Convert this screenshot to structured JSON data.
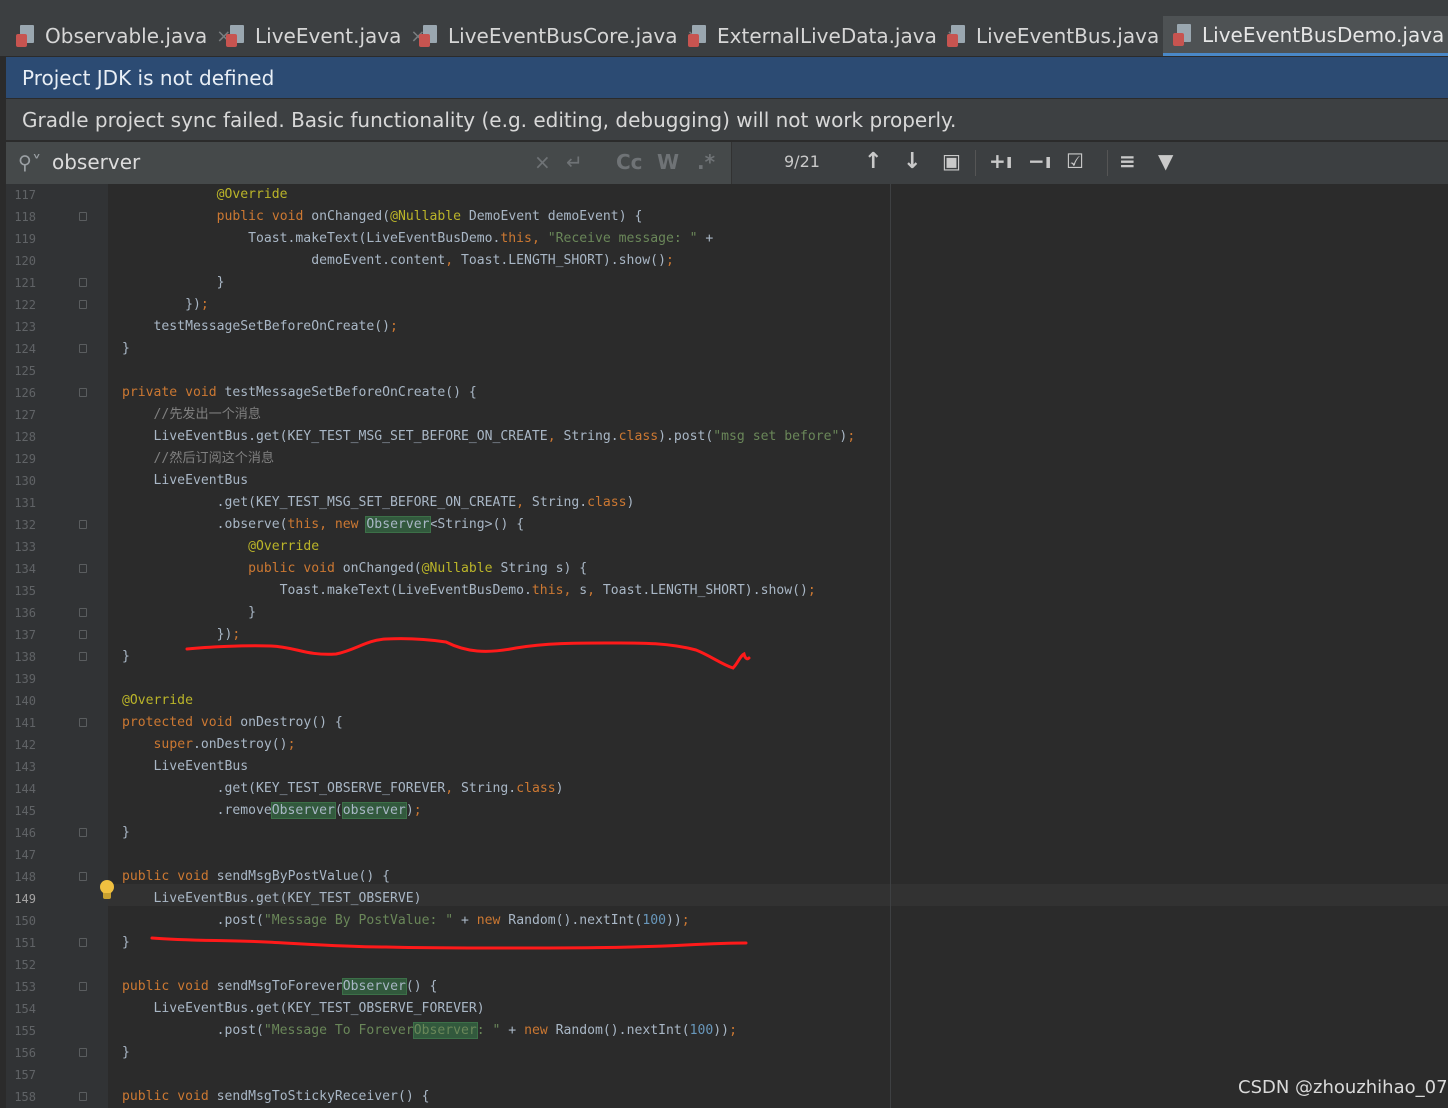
{
  "tabs": [
    {
      "label": "Observable.java",
      "active": false
    },
    {
      "label": "LiveEvent.java",
      "active": false
    },
    {
      "label": "LiveEventBusCore.java",
      "active": false
    },
    {
      "label": "ExternalLiveData.java",
      "active": false
    },
    {
      "label": "LiveEventBus.java",
      "active": false
    },
    {
      "label": "LiveEventBusDemo.java",
      "active": true
    }
  ],
  "tab_close_glyph": "×",
  "banners": {
    "jdk": "Project JDK is not defined",
    "gradle": "Gradle project sync failed. Basic functionality (e.g. editing, debugging) will not work properly."
  },
  "search": {
    "query": "observer",
    "match_case_label": "Cc",
    "words_label": "W",
    "regex_label": ".*",
    "counter": "9/21"
  },
  "editor": {
    "current_line": 149,
    "lines": [
      {
        "n": "117",
        "t": "                @Override"
      },
      {
        "n": "118",
        "t": "                public void onChanged(@Nullable DemoEvent demoEvent) {"
      },
      {
        "n": "119",
        "t": "                    Toast.makeText(LiveEventBusDemo.this, \"Receive message: \" +"
      },
      {
        "n": "120",
        "t": "                            demoEvent.content, Toast.LENGTH_SHORT).show();"
      },
      {
        "n": "121",
        "t": "                }"
      },
      {
        "n": "122",
        "t": "            });"
      },
      {
        "n": "123",
        "t": "        testMessageSetBeforeOnCreate();"
      },
      {
        "n": "124",
        "t": "    }"
      },
      {
        "n": "125",
        "t": ""
      },
      {
        "n": "126",
        "t": "    private void testMessageSetBeforeOnCreate() {"
      },
      {
        "n": "127",
        "t": "        //先发出一个消息"
      },
      {
        "n": "128",
        "t": "        LiveEventBus.get(KEY_TEST_MSG_SET_BEFORE_ON_CREATE, String.class).post(\"msg set before\");"
      },
      {
        "n": "129",
        "t": "        //然后订阅这个消息"
      },
      {
        "n": "130",
        "t": "        LiveEventBus"
      },
      {
        "n": "131",
        "t": "                .get(KEY_TEST_MSG_SET_BEFORE_ON_CREATE, String.class)"
      },
      {
        "n": "132",
        "t": "                .observe(this, new Observer<String>() {"
      },
      {
        "n": "133",
        "t": "                    @Override"
      },
      {
        "n": "134",
        "t": "                    public void onChanged(@Nullable String s) {"
      },
      {
        "n": "135",
        "t": "                        Toast.makeText(LiveEventBusDemo.this, s, Toast.LENGTH_SHORT).show();"
      },
      {
        "n": "136",
        "t": "                    }"
      },
      {
        "n": "137",
        "t": "                });"
      },
      {
        "n": "138",
        "t": "    }"
      },
      {
        "n": "139",
        "t": ""
      },
      {
        "n": "140",
        "t": "    @Override"
      },
      {
        "n": "141",
        "t": "    protected void onDestroy() {"
      },
      {
        "n": "142",
        "t": "        super.onDestroy();"
      },
      {
        "n": "143",
        "t": "        LiveEventBus"
      },
      {
        "n": "144",
        "t": "                .get(KEY_TEST_OBSERVE_FOREVER, String.class)"
      },
      {
        "n": "145",
        "t": "                .removeObserver(observer);"
      },
      {
        "n": "146",
        "t": "    }"
      },
      {
        "n": "147",
        "t": ""
      },
      {
        "n": "148",
        "t": "    public void sendMsgByPostValue() {"
      },
      {
        "n": "149",
        "t": "        LiveEventBus.get(KEY_TEST_OBSERVE)"
      },
      {
        "n": "150",
        "t": "                .post(\"Message By PostValue: \" + new Random().nextInt(100));"
      },
      {
        "n": "151",
        "t": "    }"
      },
      {
        "n": "152",
        "t": ""
      },
      {
        "n": "153",
        "t": "    public void sendMsgToForeverObserver() {"
      },
      {
        "n": "154",
        "t": "        LiveEventBus.get(KEY_TEST_OBSERVE_FOREVER)"
      },
      {
        "n": "155",
        "t": "                .post(\"Message To ForeverObserver: \" + new Random().nextInt(100));"
      },
      {
        "n": "156",
        "t": "    }"
      },
      {
        "n": "157",
        "t": ""
      },
      {
        "n": "158",
        "t": "    public void sendMsgToStickyReceiver() {"
      }
    ]
  },
  "colors": {
    "keyword": "#cc7832",
    "string": "#6a8759",
    "annotation": "#bbb529",
    "comment": "#808080",
    "number": "#6897bb",
    "plain": "#a9b7c6",
    "match_highlight": "#32593d",
    "annotation_pen": "#ff1a1a"
  },
  "watermark": "CSDN @zhouzhihao_07"
}
